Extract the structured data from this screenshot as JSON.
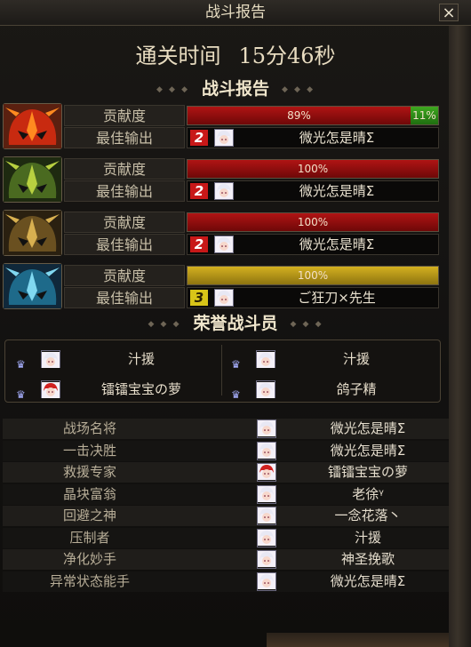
{
  "window": {
    "title": "战斗报告",
    "close_label": "×"
  },
  "clear_time": {
    "label": "通关时间",
    "value": "15分46秒"
  },
  "section_report": "战斗报告",
  "section_honor": "荣誉战斗员",
  "colors": {
    "bar_red": "#b01414",
    "bar_gold": "#d4b020",
    "bar_green": "#3ea820",
    "rank2": "#c81818",
    "rank3": "#d8c418"
  },
  "players": [
    {
      "icon": "red-demon-helmet-icon",
      "contribution_label": "贡献度",
      "contribution": {
        "percent": 89,
        "text": "89%",
        "color": "red",
        "extra_percent": 11,
        "extra_text": "11%"
      },
      "best_label": "最佳输出",
      "best_rank": "2",
      "best_name": "微光怎是晴Σ"
    },
    {
      "icon": "green-demon-helmet-icon",
      "contribution_label": "贡献度",
      "contribution": {
        "percent": 100,
        "text": "100%",
        "color": "red"
      },
      "best_label": "最佳输出",
      "best_rank": "2",
      "best_name": "微光怎是晴Σ"
    },
    {
      "icon": "gold-demon-helmet-icon",
      "contribution_label": "贡献度",
      "contribution": {
        "percent": 100,
        "text": "100%",
        "color": "red"
      },
      "best_label": "最佳输出",
      "best_rank": "2",
      "best_name": "微光怎是晴Σ"
    },
    {
      "icon": "blue-demon-helmet-icon",
      "contribution_label": "贡献度",
      "contribution": {
        "percent": 100,
        "text": "100%",
        "color": "gold"
      },
      "best_label": "最佳输出",
      "best_rank": "3",
      "best_name": "ご狂刀×先生"
    }
  ],
  "honor": [
    {
      "name": "汁援",
      "avatar": "white-hair-avatar-icon"
    },
    {
      "name": "汁援",
      "avatar": "white-hair-avatar-icon"
    },
    {
      "name": "镭镭宝宝の萝",
      "avatar": "red-hair-avatar-icon"
    },
    {
      "name": "鸽子精",
      "avatar": "white-hair-avatar-icon"
    }
  ],
  "awards": [
    {
      "title": "战场名将",
      "name": "微光怎是晴Σ"
    },
    {
      "title": "一击决胜",
      "name": "微光怎是晴Σ"
    },
    {
      "title": "救援专家",
      "name": "镭镭宝宝の萝"
    },
    {
      "title": "晶块富翁",
      "name": "老徐ᵞ"
    },
    {
      "title": "回避之神",
      "name": "一念花落丶"
    },
    {
      "title": "压制者",
      "name": "汁援"
    },
    {
      "title": "净化妙手",
      "name": "神圣挽歌"
    },
    {
      "title": "异常状态能手",
      "name": "微光怎是晴Σ"
    }
  ]
}
